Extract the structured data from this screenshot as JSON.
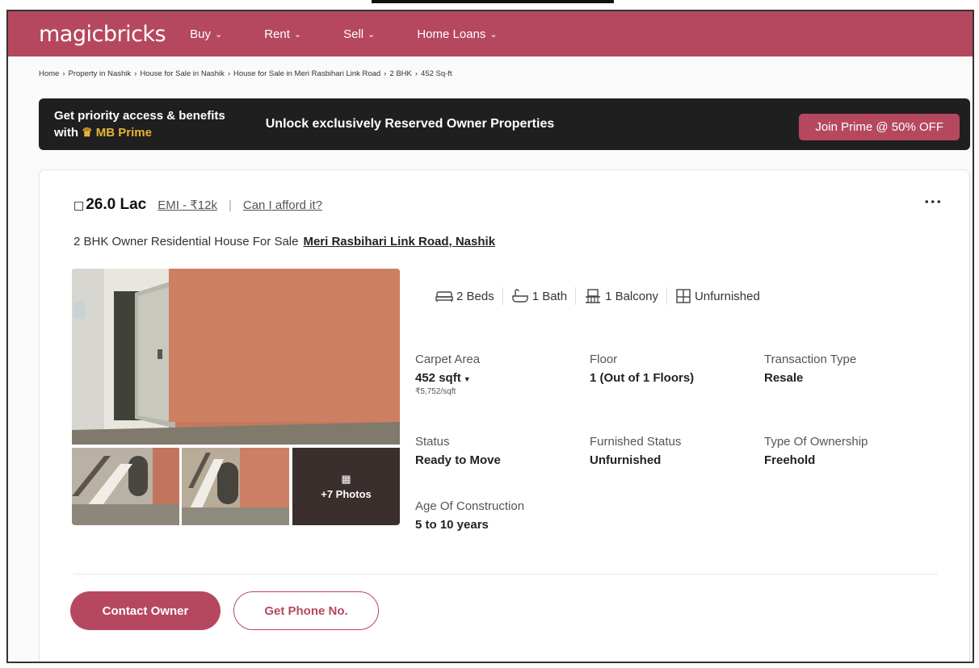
{
  "header": {
    "logo": "magicbricks",
    "nav": [
      {
        "label": "Buy"
      },
      {
        "label": "Rent"
      },
      {
        "label": "Sell"
      },
      {
        "label": "Home Loans"
      }
    ]
  },
  "breadcrumb": [
    "Home",
    "Property in Nashik",
    "House for Sale in Nashik",
    "House for Sale in Meri Rasbihari Link Road",
    "2 BHK",
    "452 Sq-ft"
  ],
  "prime": {
    "line1": "Get priority access & benefits",
    "line2_prefix": "with",
    "line2_brand": "MB Prime",
    "center": "Unlock exclusively Reserved Owner Properties",
    "button": "Join Prime @ 50% OFF"
  },
  "listing": {
    "price": "26.0 Lac",
    "emi": "EMI - ₹12k",
    "afford": "Can I afford it?",
    "title": "2 BHK Owner Residential House For Sale",
    "location": "Meri Rasbihari Link Road, Nashik",
    "photos_more": "+7 Photos",
    "features": [
      {
        "label": "2 Beds",
        "icon": "bed-icon"
      },
      {
        "label": "1 Bath",
        "icon": "bath-icon"
      },
      {
        "label": "1 Balcony",
        "icon": "balcony-icon"
      },
      {
        "label": "Unfurnished",
        "icon": "furniture-icon"
      }
    ],
    "summary": {
      "carpet_area": {
        "label": "Carpet Area",
        "value": "452 sqft",
        "sub": "₹5,752/sqft"
      },
      "floor": {
        "label": "Floor",
        "value": "1 (Out of 1 Floors)"
      },
      "transaction": {
        "label": "Transaction Type",
        "value": "Resale"
      },
      "status": {
        "label": "Status",
        "value": "Ready to Move"
      },
      "furnished": {
        "label": "Furnished Status",
        "value": "Unfurnished"
      },
      "ownership": {
        "label": "Type Of Ownership",
        "value": "Freehold"
      },
      "age": {
        "label": "Age Of Construction",
        "value": "5 to 10 years"
      }
    },
    "buttons": {
      "contact": "Contact Owner",
      "phone": "Get Phone No."
    }
  },
  "colors": {
    "brand": "#b5485f",
    "prime_bg": "#1f1f1f",
    "gold": "#e7b437"
  }
}
